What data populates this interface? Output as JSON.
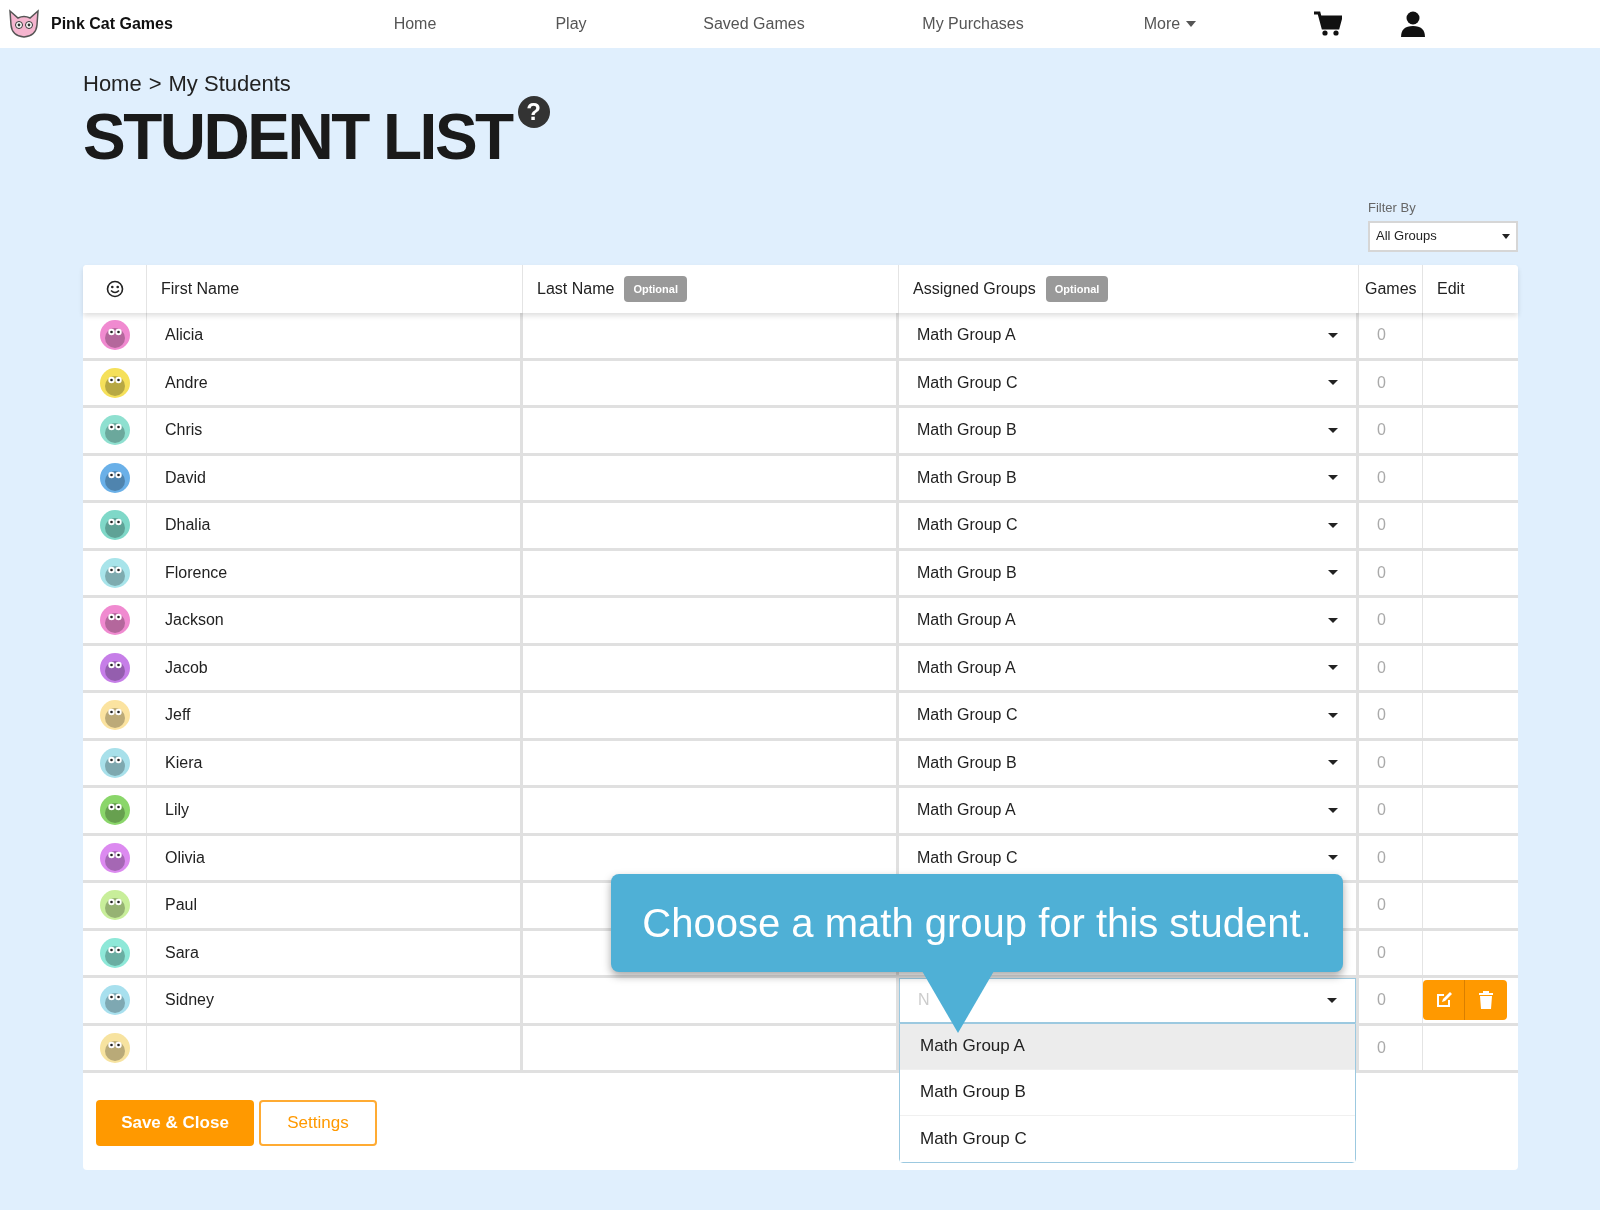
{
  "nav": {
    "brand": "Pink Cat Games",
    "links": [
      {
        "label": "Home",
        "kind": "link"
      },
      {
        "label": "Play",
        "kind": "link"
      },
      {
        "label": "Saved Games",
        "kind": "link"
      },
      {
        "label": "My Purchases",
        "kind": "link"
      },
      {
        "label": "More",
        "kind": "menu"
      }
    ]
  },
  "breadcrumb": {
    "items": [
      "Home",
      "My Students"
    ],
    "separator": ">"
  },
  "title": "STUDENT LIST",
  "help": "?",
  "filter": {
    "label": "Filter By",
    "value": "All Groups"
  },
  "table": {
    "columns": [
      {
        "kind": "avatar"
      },
      {
        "label": "First Name"
      },
      {
        "label": "Last Name",
        "badge": "Optional"
      },
      {
        "label": "Assigned Groups",
        "badge": "Optional"
      },
      {
        "label": "Games"
      },
      {
        "label": "Edit"
      }
    ],
    "rows": [
      {
        "first_name": "Alicia",
        "color": "#f08ad0",
        "group": "Math Group A",
        "games": "0"
      },
      {
        "first_name": "Andre",
        "color": "#f5e05a",
        "group": "Math Group C",
        "games": "0"
      },
      {
        "first_name": "Chris",
        "color": "#8fe0d0",
        "group": "Math Group B",
        "games": "0"
      },
      {
        "first_name": "David",
        "color": "#6ab0e8",
        "group": "Math Group B",
        "games": "0"
      },
      {
        "first_name": "Dhalia",
        "color": "#7fd8c8",
        "group": "Math Group C",
        "games": "0"
      },
      {
        "first_name": "Florence",
        "color": "#a8e4ea",
        "group": "Math Group B",
        "games": "0"
      },
      {
        "first_name": "Jackson",
        "color": "#f08ad0",
        "group": "Math Group A",
        "games": "0"
      },
      {
        "first_name": "Jacob",
        "color": "#c67ee8",
        "group": "Math Group A",
        "games": "0"
      },
      {
        "first_name": "Jeff",
        "color": "#fbe3a0",
        "group": "Math Group C",
        "games": "0"
      },
      {
        "first_name": "Kiera",
        "color": "#a8e0ea",
        "group": "Math Group B",
        "games": "0"
      },
      {
        "first_name": "Lily",
        "color": "#8ad66a",
        "group": "Math Group A",
        "games": "0"
      },
      {
        "first_name": "Olivia",
        "color": "#dc8af0",
        "group": "Math Group C",
        "games": "0"
      },
      {
        "first_name": "Paul",
        "color": "#c8ee9a",
        "games": "0"
      },
      {
        "first_name": "Sara",
        "color": "#8ee8d8",
        "games": "0"
      },
      {
        "first_name": "Sidney",
        "color": "#a8e0ee",
        "placeholder": "N",
        "games": "0",
        "show_actions": true,
        "options": [
          {
            "label": "Math Group A",
            "highlighted": true
          },
          {
            "label": "Math Group B",
            "highlighted": false
          },
          {
            "label": "Math Group C",
            "highlighted": false
          }
        ]
      },
      {
        "color": "#f7e3a0",
        "games": "0"
      }
    ]
  },
  "buttons": [
    {
      "label": "Save & Close",
      "kind": "primary"
    },
    {
      "label": "Settings",
      "kind": "outline"
    }
  ],
  "tooltip": {
    "text": "Choose a math group for this student."
  }
}
